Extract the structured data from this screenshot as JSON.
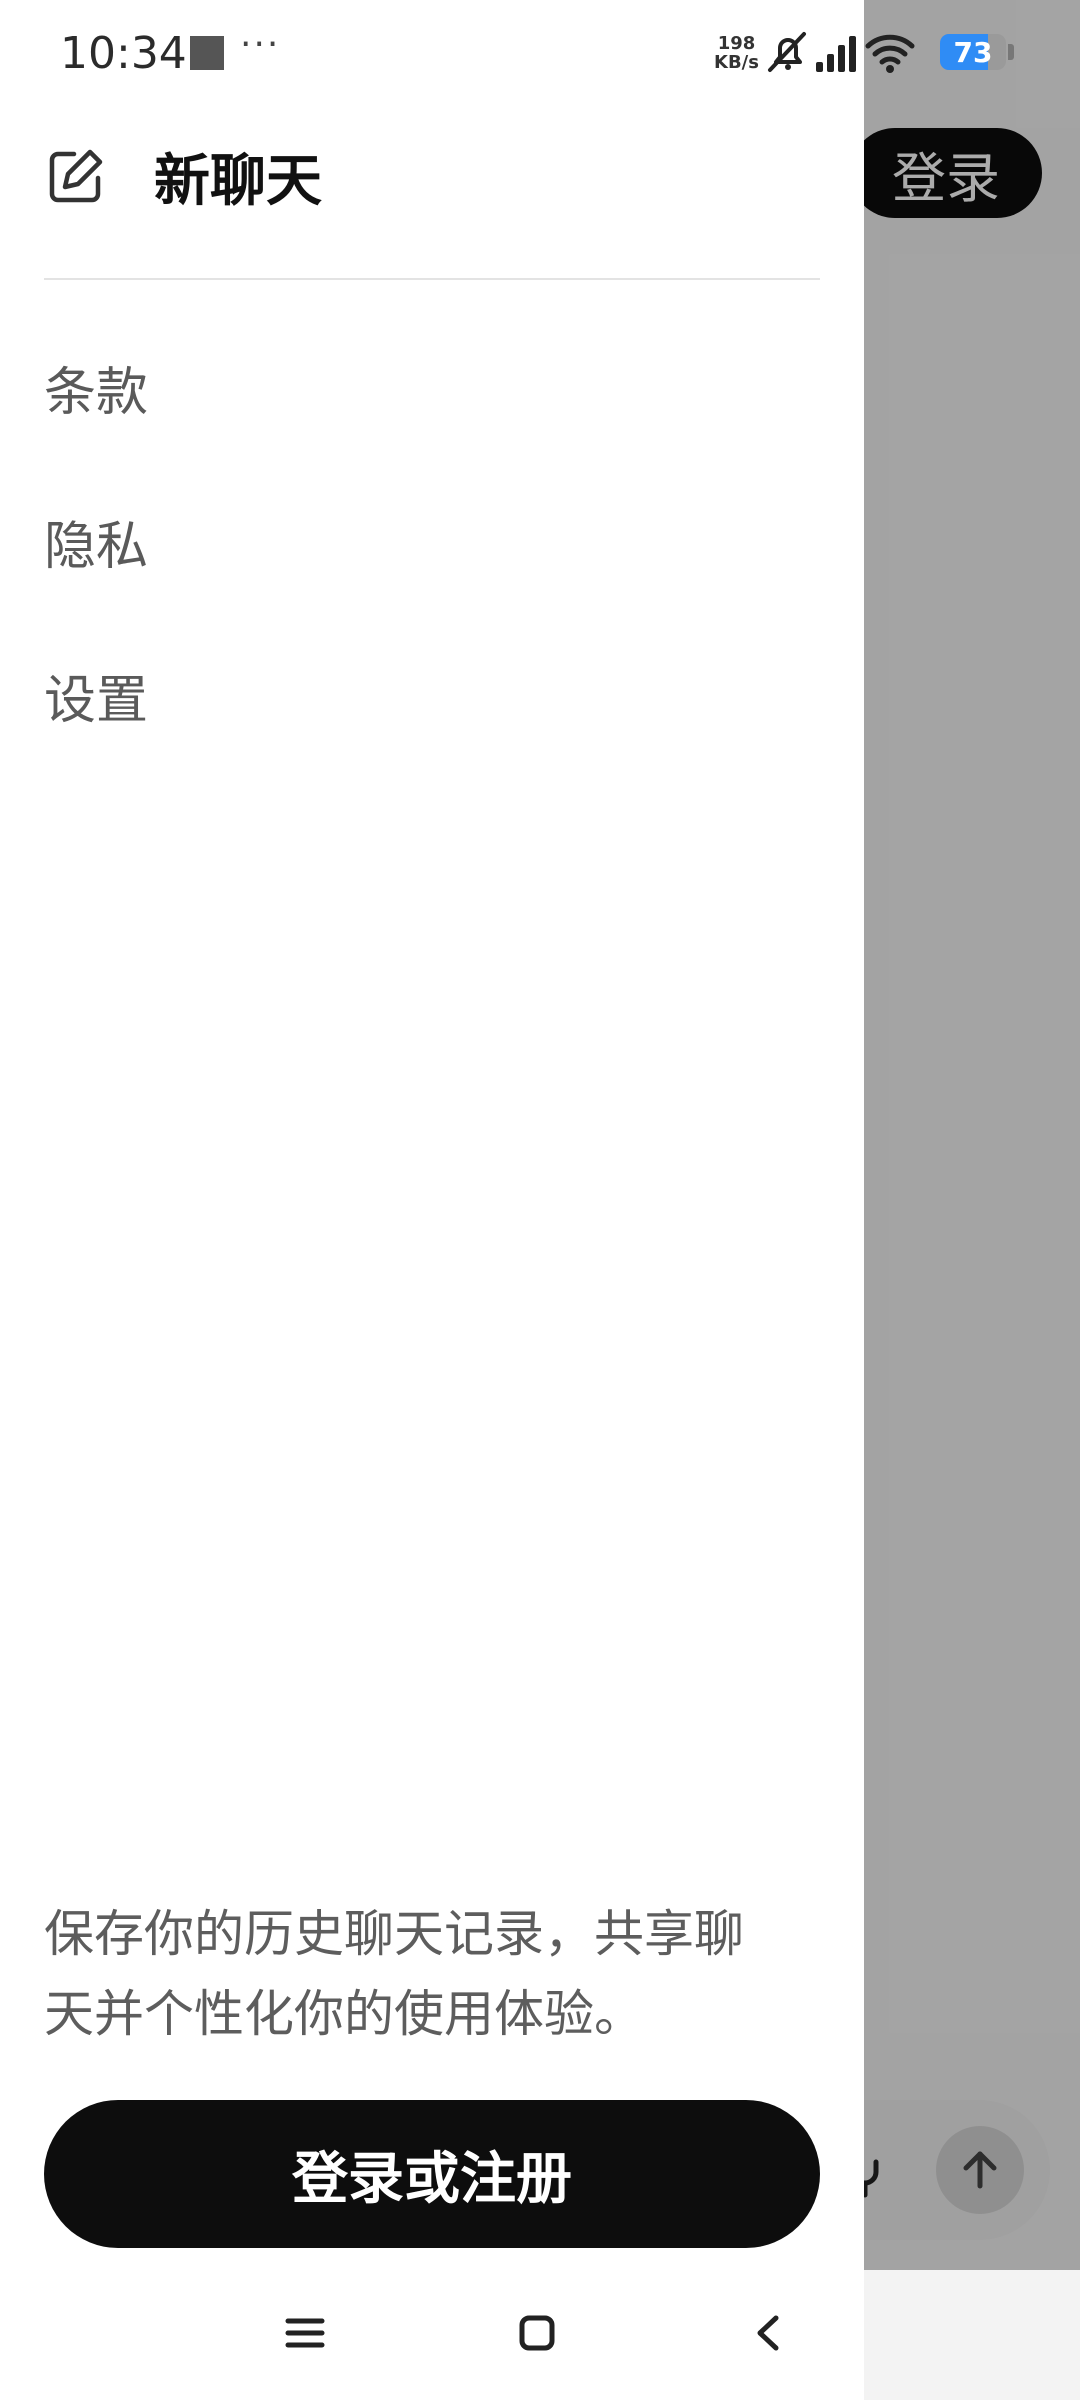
{
  "status_bar": {
    "time": "10:34",
    "overflow": "···",
    "net_speed_value": "198",
    "net_speed_unit": "KB/s",
    "battery": "73",
    "battery_level": 0.73,
    "accent": "#2f8cf5"
  },
  "drawer": {
    "new_chat_label": "新聊天",
    "menu": {
      "terms": "条款",
      "privacy": "隐私",
      "settings": "设置"
    },
    "promo_line1": "保存你的历史聊天记录，共享聊",
    "promo_line2": "天并个性化你的使用体验。",
    "signup_button": "登录或注册"
  },
  "background": {
    "login_button": "登录"
  },
  "icons": {
    "edit": "edit-icon",
    "mute": "bell-off-icon",
    "signal": "cellular-signal-icon",
    "wifi": "wifi-icon",
    "mic": "mic-icon",
    "send": "arrow-up-icon",
    "nav_menu": "menu-icon",
    "nav_home": "home-icon",
    "nav_back": "back-icon"
  }
}
